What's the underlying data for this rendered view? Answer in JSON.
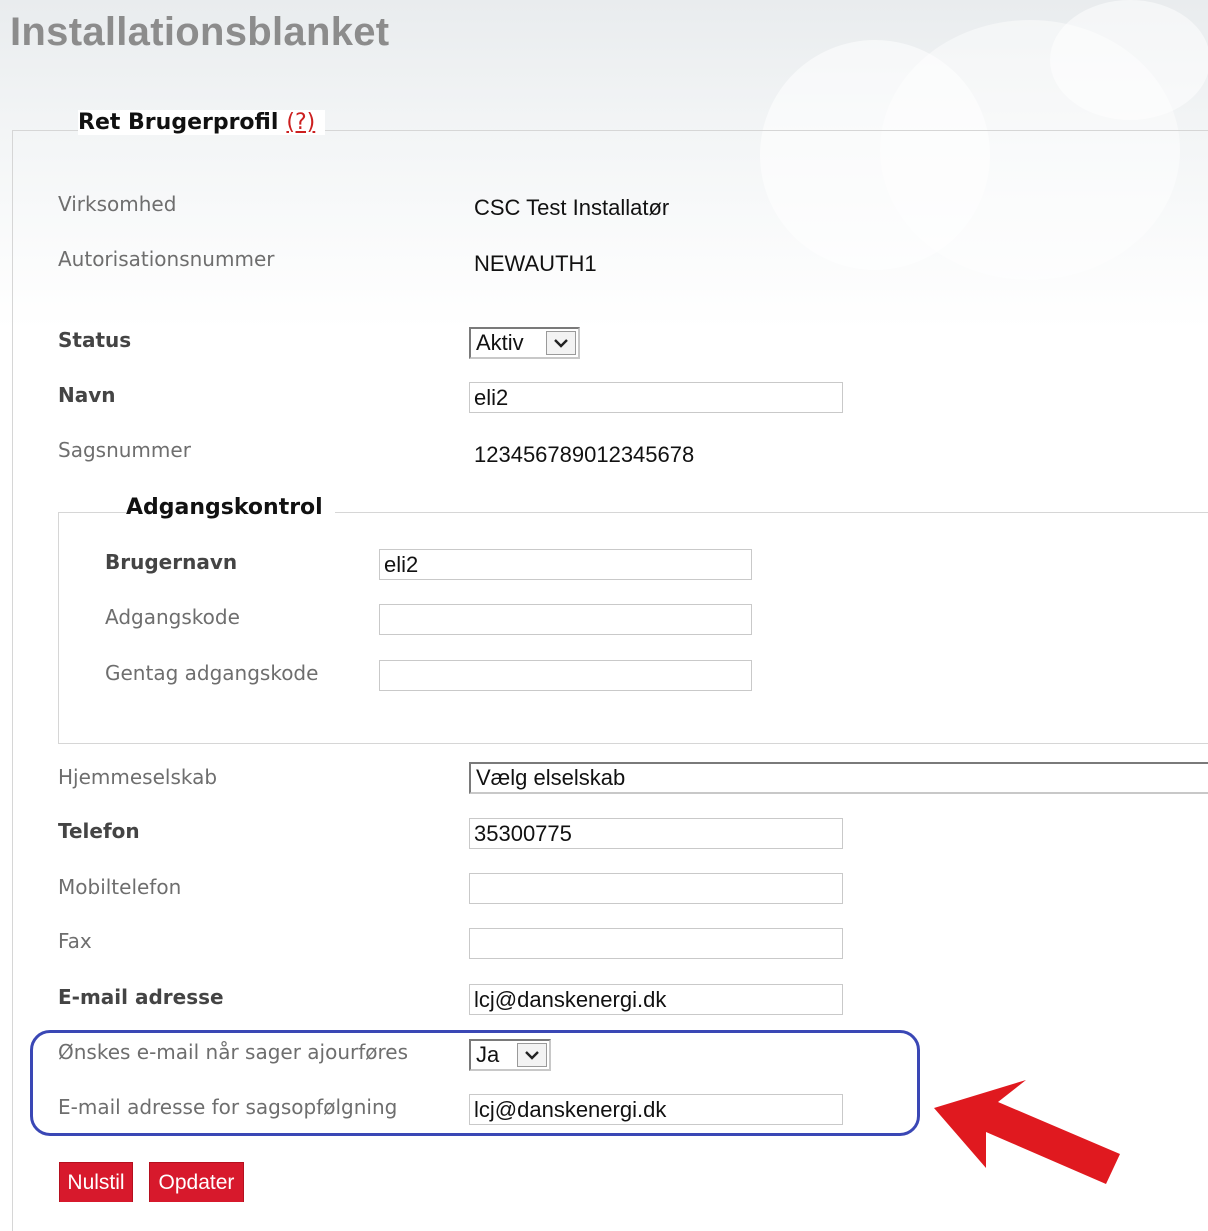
{
  "page": {
    "title": "Installationsblanket"
  },
  "profile": {
    "legend": "Ret Brugerprofil",
    "help_link": "(?)",
    "virksomhed": {
      "label": "Virksomhed",
      "value": "CSC Test Installatør"
    },
    "autorisation": {
      "label": "Autorisationsnummer",
      "value": "NEWAUTH1"
    },
    "status": {
      "label": "Status",
      "value": "Aktiv"
    },
    "navn": {
      "label": "Navn",
      "value": "eli2"
    },
    "sagsnummer": {
      "label": "Sagsnummer",
      "value": "123456789012345678"
    }
  },
  "access": {
    "legend": "Adgangskontrol",
    "brugernavn": {
      "label": "Brugernavn",
      "value": "eli2"
    },
    "adgangskode": {
      "label": "Adgangskode",
      "value": ""
    },
    "gentag": {
      "label": "Gentag adgangskode",
      "value": ""
    }
  },
  "contact": {
    "hjemmeselskab": {
      "label": "Hjemmeselskab",
      "value": "Vælg elselskab"
    },
    "telefon": {
      "label": "Telefon",
      "value": "35300775"
    },
    "mobil": {
      "label": "Mobiltelefon",
      "value": ""
    },
    "fax": {
      "label": "Fax",
      "value": ""
    },
    "email": {
      "label": "E-mail adresse",
      "value": "lcj@danskenergi.dk"
    },
    "notify": {
      "label": "Ønskes e-mail når sager ajourføres",
      "value": "Ja"
    },
    "followup_email": {
      "label": "E-mail adresse for sagsopfølgning",
      "value": "lcj@danskenergi.dk"
    }
  },
  "buttons": {
    "reset": "Nulstil",
    "update": "Opdater"
  },
  "colors": {
    "accent_red": "#d7192c",
    "highlight_blue": "#3a47b5"
  }
}
